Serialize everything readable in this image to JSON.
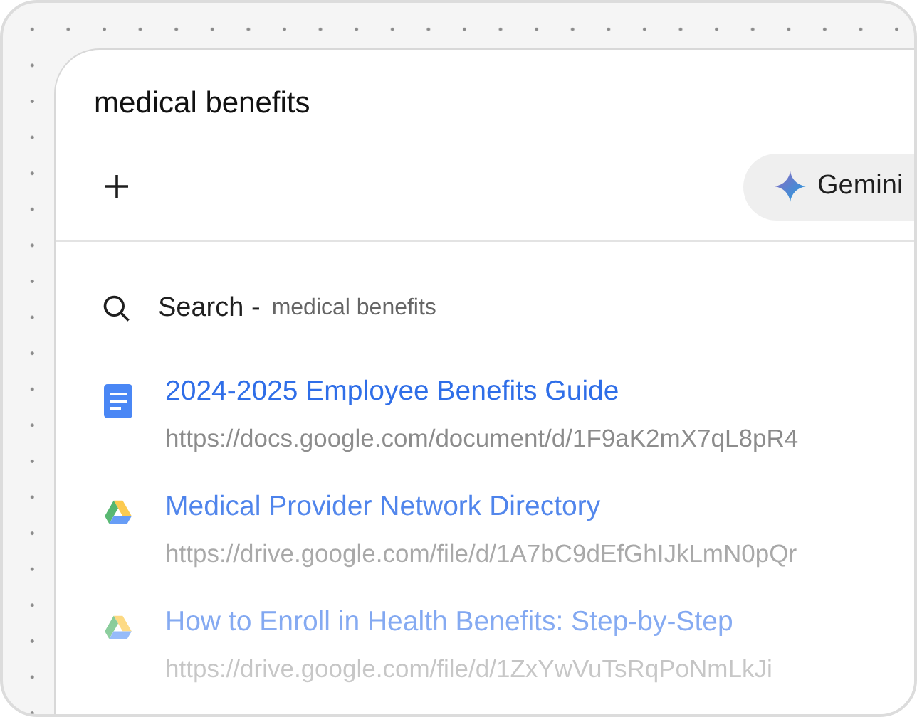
{
  "query": "medical benefits",
  "model_chip": {
    "label": "Gemini"
  },
  "search_row": {
    "label": "Search -",
    "query": "medical benefits"
  },
  "results": [
    {
      "kind": "doc",
      "title": "2024-2025 Employee Benefits Guide",
      "url": "https://docs.google.com/document/d/1F9aK2mX7qL8pR4"
    },
    {
      "kind": "drive",
      "title": "Medical Provider Network Directory",
      "url": "https://drive.google.com/file/d/1A7bC9dEfGhIJkLmN0pQr"
    },
    {
      "kind": "drive",
      "title": "How to Enroll in Health Benefits: Step-by-Step",
      "url": "https://drive.google.com/file/d/1ZxYwVuTsRqPoNmLkJi"
    }
  ]
}
